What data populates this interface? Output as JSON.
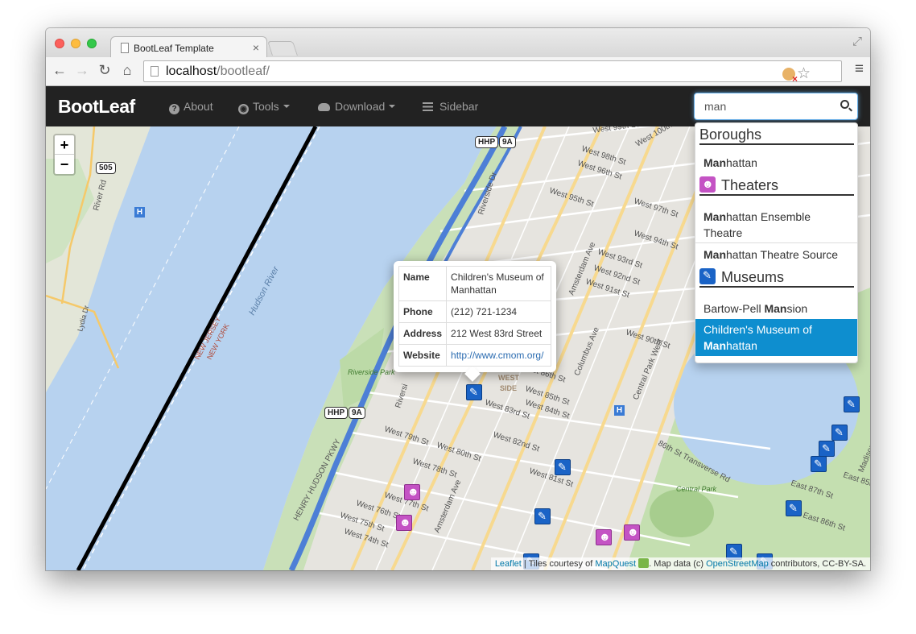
{
  "browser": {
    "tab_title": "BootLeaf Template",
    "tab_close": "×",
    "url_host": "localhost",
    "url_path": "/bootleaf/",
    "back": "←",
    "forward": "→",
    "reload": "↻",
    "home": "⌂",
    "star": "☆",
    "menu": "≡",
    "fullscreen": "⤢"
  },
  "navbar": {
    "brand": "BootLeaf",
    "about": "About",
    "tools": "Tools",
    "download": "Download",
    "sidebar": "Sidebar"
  },
  "search": {
    "value": "man"
  },
  "dropdown": {
    "groups": [
      {
        "title": "Boroughs",
        "icon": "borough",
        "items": [
          {
            "match": "Man",
            "rest": "hattan"
          }
        ]
      },
      {
        "title": "Theaters",
        "icon": "theater-icon",
        "items": [
          {
            "match": "Man",
            "rest": "hattan Ensemble Theatre"
          },
          {
            "match": "Man",
            "rest": "hattan Theatre Source"
          }
        ]
      },
      {
        "title": "Museums",
        "icon": "museum-icon",
        "items": [
          {
            "before": "Bartow-Pell ",
            "match": "Man",
            "rest": "sion"
          },
          {
            "before": "Children's Museum of ",
            "match": "Man",
            "rest": "hattan",
            "active": true
          }
        ]
      }
    ]
  },
  "popup": {
    "rows": [
      {
        "key": "Name",
        "value": "Children's Museum of Manhattan"
      },
      {
        "key": "Phone",
        "value": "(212) 721-1234"
      },
      {
        "key": "Address",
        "value": "212 West 83rd Street"
      },
      {
        "key": "Website",
        "value": "http://www.cmom.org/"
      }
    ]
  },
  "zoom": {
    "in": "+",
    "out": "−"
  },
  "map_labels": {
    "hudson_river": "Hudson River",
    "new_jersey": "NEW JERSEY",
    "new_york": "NEW YORK",
    "riverside_dr": "Riverside Dr",
    "riverside_park": "Riverside Park",
    "henry_hudson": "HENRY HUDSON PKWY",
    "west_side": "WEST SIDE",
    "central_park": "Central Park",
    "transverse": "86th St Transverse Rd",
    "amsterdam": "Amsterdam Ave",
    "columbus": "Columbus Ave",
    "cpw": "Central Park West",
    "madison": "Madison",
    "river_rd": "River Rd",
    "lydia": "Lydia Dr",
    "route_505": "505",
    "hhp": "HHP",
    "route_9a": "9A",
    "hospital": "H",
    "streets": [
      "West 99th St",
      "West 98th St",
      "West 97th St",
      "West 96th St",
      "West 95th St",
      "West 94th St",
      "West 93rd St",
      "West 92nd St",
      "West 91st St",
      "West 90th St",
      "West 86th St",
      "West 85th St",
      "West 84th St",
      "West 83rd St",
      "West 82nd St",
      "West 81st St",
      "West 80th St",
      "West 79th St",
      "West 78th St",
      "West 77th St",
      "West 76th St",
      "West 75th St",
      "West 74th St",
      "West 100th St",
      "East 86th St",
      "East 85th St",
      "East 87th St"
    ]
  },
  "attribution": {
    "leaflet": "Leaflet",
    "tiles": " | Tiles courtesy of ",
    "mapquest": "MapQuest",
    "mapdata": ". Map data (c) ",
    "osm": "OpenStreetMap",
    "license": " contributors, CC-BY-SA."
  }
}
